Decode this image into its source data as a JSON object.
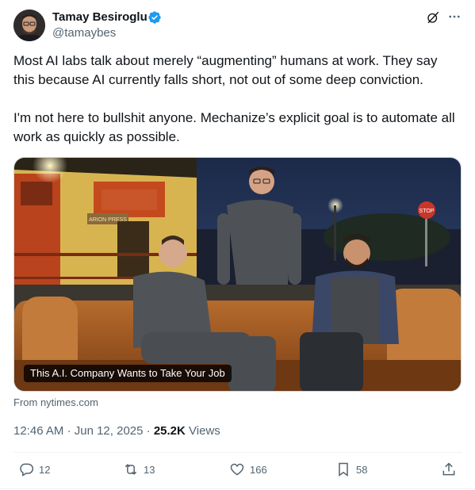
{
  "author": {
    "name": "Tamay Besiroglu",
    "handle": "@tamaybes"
  },
  "tweet": {
    "text": "Most AI labs talk about merely “augmenting” humans at work. They say this because AI currently falls short, not out of some deep conviction.\n\nI'm not here to bullshit anyone. Mechanize’s explicit goal is to automate all work as quickly as possible."
  },
  "media": {
    "caption": "This A.I. Company Wants to Take Your Job",
    "source": "From nytimes.com",
    "sign_text": "ARION PRESS",
    "stop_text": "STOP"
  },
  "meta": {
    "time": "12:46 AM",
    "date": "Jun 12, 2025",
    "views_count": "25.2K",
    "views_label": "Views"
  },
  "actions": {
    "replies": "12",
    "reposts": "13",
    "likes": "166",
    "bookmarks": "58"
  },
  "colors": {
    "verified": "#1d9bf0",
    "secondary_text": "#536471"
  }
}
